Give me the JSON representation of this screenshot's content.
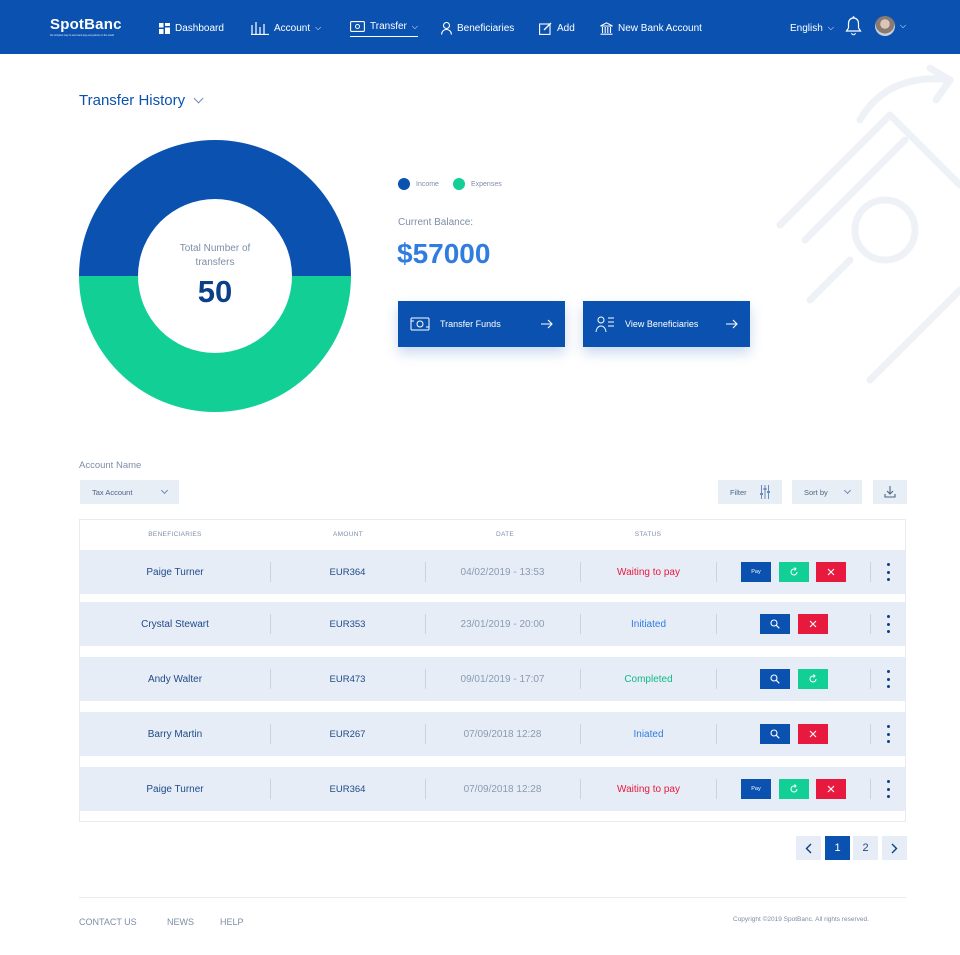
{
  "brand": {
    "name": "SpotBanc",
    "tagline": "the simplest way to send and pay everywhere in the world"
  },
  "nav": {
    "dashboard": "Dashboard",
    "account": "Account",
    "transfer": "Transfer",
    "beneficiaries": "Beneficiaries",
    "add": "Add",
    "new_account": "New Bank Account",
    "language": "English"
  },
  "page": {
    "title": "Transfer History"
  },
  "summary": {
    "total_label": "Total Number of transfers",
    "total_value": "50",
    "legend_income": "Income",
    "legend_expenses": "Expenses",
    "balance_label": "Current Balance:",
    "balance_value": "$57000",
    "transfer_funds": "Transfer Funds",
    "view_beneficiaries": "View Beneficiaries"
  },
  "chart_data": {
    "type": "pie",
    "categories": [
      "Income",
      "Expenses"
    ],
    "values": [
      50,
      50
    ],
    "colors": [
      "#0b52b0",
      "#12cf95"
    ]
  },
  "filters": {
    "account_label": "Account Name",
    "account_value": "Tax Account",
    "filter_label": "Filter",
    "sort_label": "Sort by"
  },
  "table": {
    "headers": [
      "BENEFICIARIES",
      "AMOUNT",
      "DATE",
      "STATUS"
    ],
    "rows": [
      {
        "name": "Paige Turner",
        "amount": "EUR364",
        "date": "04/02/2019 - 13:53",
        "status": "Waiting to pay",
        "status_color": "#e8193f",
        "actions": [
          "pay",
          "retry",
          "cancel"
        ]
      },
      {
        "name": "Crystal Stewart",
        "amount": "EUR353",
        "date": "23/01/2019 - 20:00",
        "status": "Initiated",
        "status_color": "#2f7de0",
        "actions": [
          "view",
          "cancel"
        ]
      },
      {
        "name": "Andy Walter",
        "amount": "EUR473",
        "date": "09/01/2019 - 17:07",
        "status": "Completed",
        "status_color": "#12b886",
        "actions": [
          "view",
          "retry"
        ]
      },
      {
        "name": "Barry Martin",
        "amount": "EUR267",
        "date": "07/09/2018 12:28",
        "status": "Iniated",
        "status_color": "#2f7de0",
        "actions": [
          "view",
          "cancel"
        ]
      },
      {
        "name": "Paige Turner",
        "amount": "EUR364",
        "date": "07/09/2018 12:28",
        "status": "Waiting to pay",
        "status_color": "#e8193f",
        "actions": [
          "pay",
          "retry",
          "cancel"
        ]
      }
    ],
    "pay_label": "Pay"
  },
  "pagination": {
    "pages": [
      "1",
      "2"
    ],
    "current": "1"
  },
  "footer": {
    "contact": "CONTACT US",
    "news": "NEWS",
    "help": "HELP",
    "copyright": "Copyright ©2019 SpotBanc. All rights reserved."
  },
  "colors": {
    "primary": "#0b52b0",
    "accent": "#12cf95",
    "danger": "#e8193f",
    "row_bg": "#e6edf6"
  }
}
